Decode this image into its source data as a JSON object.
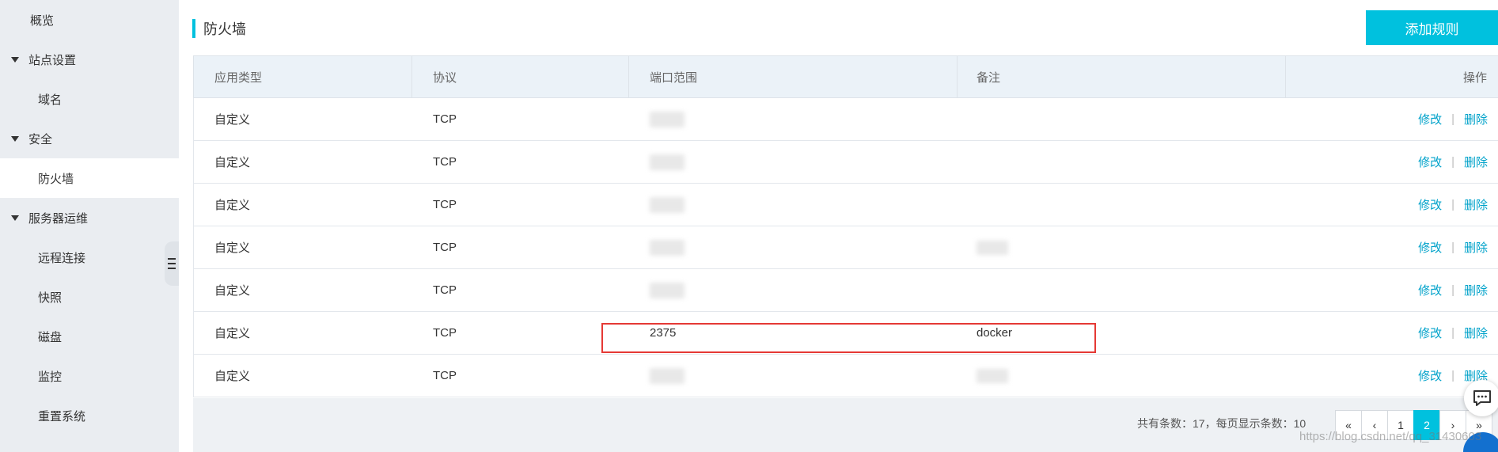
{
  "sidebar": {
    "items": [
      {
        "label": "概览",
        "type": "plain"
      },
      {
        "label": "站点设置",
        "type": "group"
      },
      {
        "label": "域名",
        "type": "sub"
      },
      {
        "label": "安全",
        "type": "group"
      },
      {
        "label": "防火墙",
        "type": "sub",
        "active": true
      },
      {
        "label": "服务器运维",
        "type": "group"
      },
      {
        "label": "远程连接",
        "type": "sub"
      },
      {
        "label": "快照",
        "type": "sub"
      },
      {
        "label": "磁盘",
        "type": "sub"
      },
      {
        "label": "监控",
        "type": "sub"
      },
      {
        "label": "重置系统",
        "type": "sub"
      }
    ]
  },
  "header": {
    "title": "防火墙",
    "add_button": "添加规则"
  },
  "table": {
    "columns": [
      "应用类型",
      "协议",
      "端口范围",
      "备注",
      "操作"
    ],
    "rows": [
      {
        "type": "自定义",
        "protocol": "TCP",
        "port": "",
        "note": "",
        "port_hidden": true,
        "note_hidden": false
      },
      {
        "type": "自定义",
        "protocol": "TCP",
        "port": "",
        "note": "",
        "port_hidden": true,
        "note_hidden": false
      },
      {
        "type": "自定义",
        "protocol": "TCP",
        "port": "",
        "note": "",
        "port_hidden": true,
        "note_hidden": false
      },
      {
        "type": "自定义",
        "protocol": "TCP",
        "port": "",
        "note": "",
        "port_hidden": true,
        "note_hidden": true
      },
      {
        "type": "自定义",
        "protocol": "TCP",
        "port": "",
        "note": "",
        "port_hidden": true,
        "note_hidden": false
      },
      {
        "type": "自定义",
        "protocol": "TCP",
        "port": "2375",
        "note": "docker",
        "port_hidden": false,
        "note_hidden": false
      },
      {
        "type": "自定义",
        "protocol": "TCP",
        "port": "",
        "note": "",
        "port_hidden": true,
        "note_hidden": true
      }
    ],
    "edit_label": "修改",
    "delete_label": "删除",
    "sep": "|"
  },
  "footer": {
    "summary": "共有条数：17，每页显示条数：10",
    "pages": [
      "«",
      "‹",
      "1",
      "2",
      "›",
      "»"
    ],
    "current_page": "2"
  },
  "watermark": "https://blog.csdn.net/qq_31430603",
  "colors": {
    "accent": "#00c1de",
    "link": "#00a2ca",
    "highlight": "#e53935"
  }
}
